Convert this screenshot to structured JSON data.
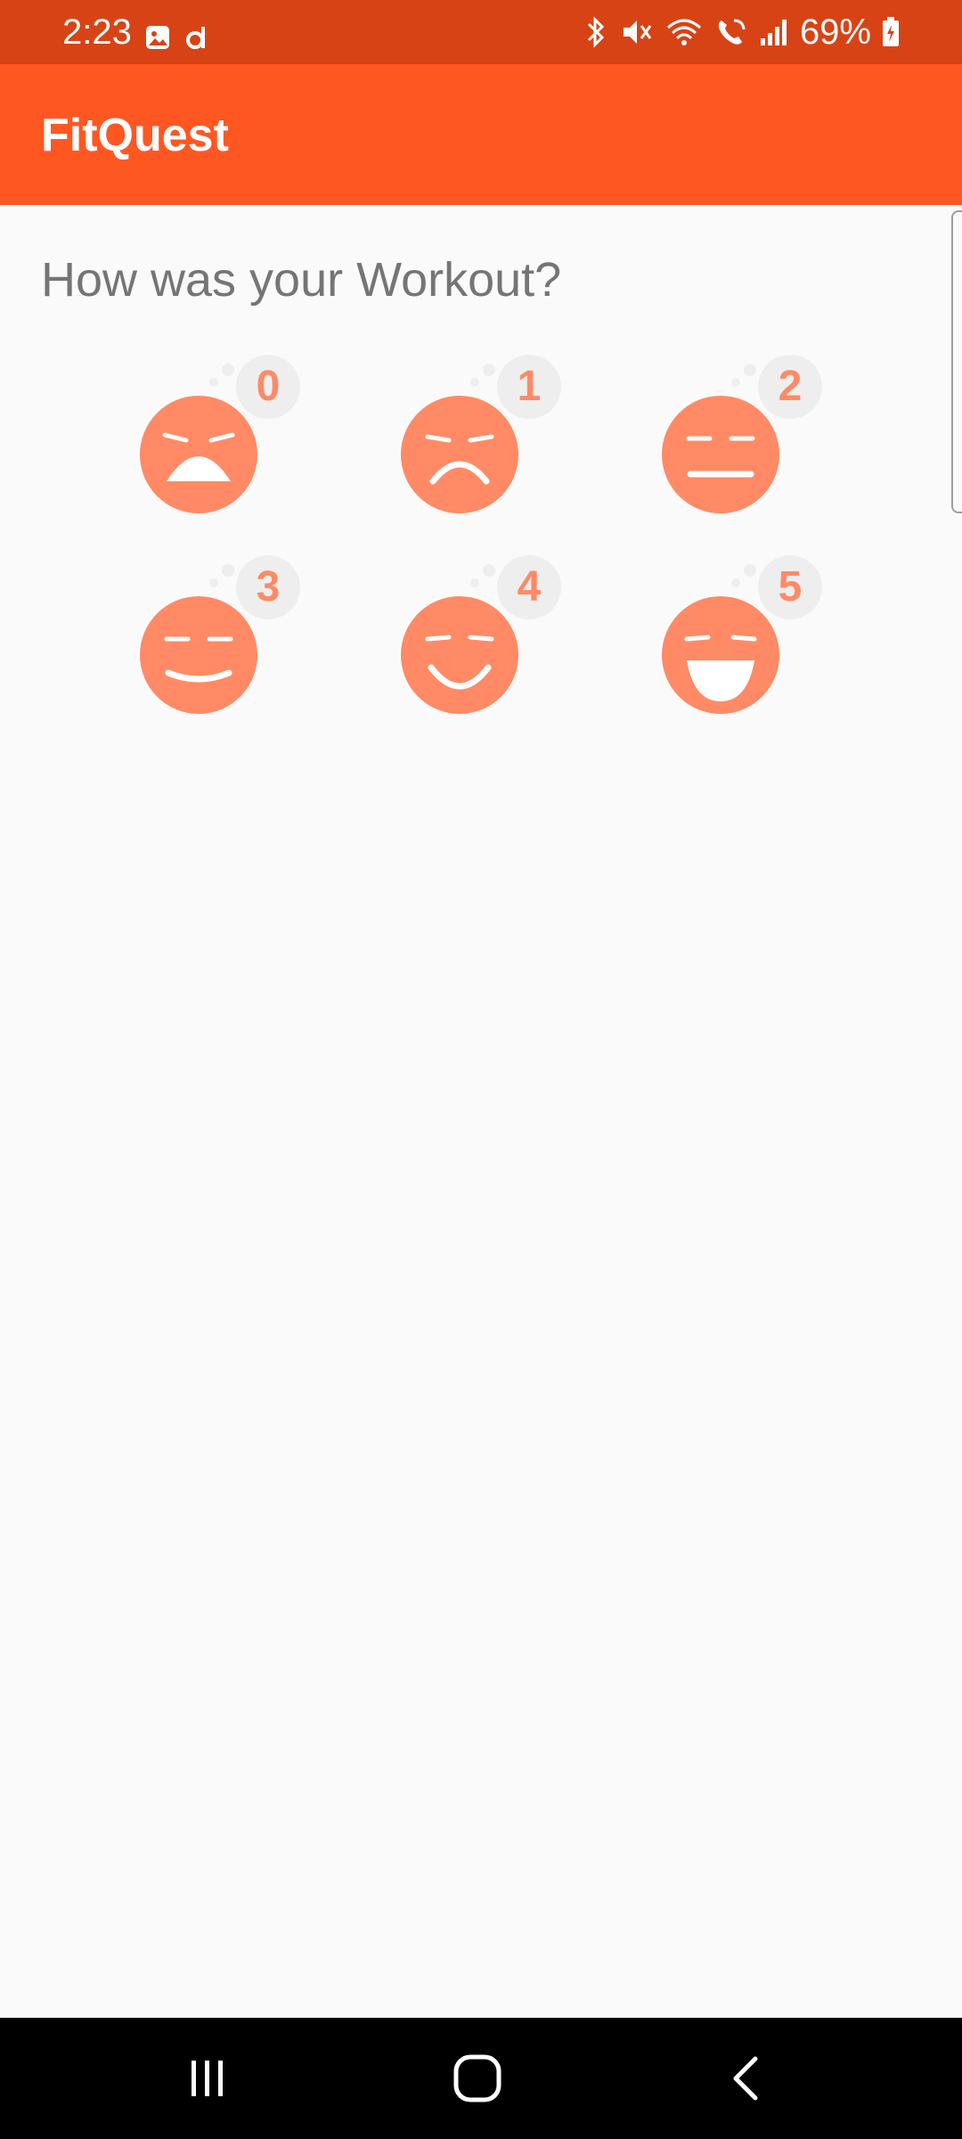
{
  "status_bar": {
    "time": "2:23",
    "battery": "69%",
    "left_icons": [
      "gallery-icon",
      "d-app-icon"
    ],
    "right_icons": [
      "bluetooth-icon",
      "mute-icon",
      "wifi-icon",
      "wifi-calling-icon",
      "signal-icon",
      "battery-charging-icon"
    ],
    "color": "#d84315"
  },
  "app_bar": {
    "title": "FitQuest",
    "color": "#ff5722"
  },
  "main": {
    "question": "How was your Workout?",
    "ratings": [
      {
        "value": "0",
        "face": "crying-face-icon"
      },
      {
        "value": "1",
        "face": "sad-face-icon"
      },
      {
        "value": "2",
        "face": "neutral-face-icon"
      },
      {
        "value": "3",
        "face": "slight-smile-face-icon"
      },
      {
        "value": "4",
        "face": "smile-face-icon"
      },
      {
        "value": "5",
        "face": "laughing-face-icon"
      }
    ],
    "accent": "#ff8a65"
  },
  "nav_bar": {
    "buttons": [
      "recent-apps-icon",
      "home-icon",
      "back-icon"
    ]
  }
}
